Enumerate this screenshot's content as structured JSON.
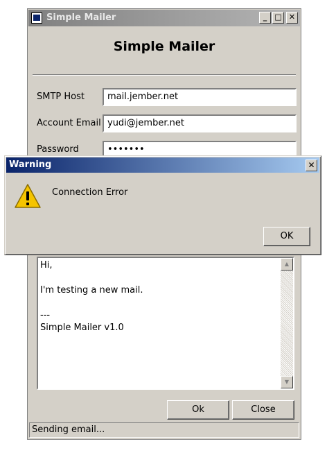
{
  "window": {
    "title": "Simple Mailer",
    "minimize_glyph": "_",
    "maximize_glyph": "□",
    "close_glyph": "✕"
  },
  "form": {
    "heading": "Simple Mailer",
    "smtp_host_label": "SMTP Host",
    "smtp_host_value": "mail.jember.net",
    "account_email_label": "Account Email",
    "account_email_value": "yudi@jember.net",
    "password_label": "Password",
    "password_value": "•••••••",
    "message_body": "Hi,\n\nI'm testing a new mail.\n\n---\nSimple Mailer v1.0"
  },
  "buttons": {
    "ok_label": "Ok",
    "close_label": "Close"
  },
  "status": {
    "text": "Sending email..."
  },
  "dialog": {
    "title": "Warning",
    "message": "Connection Error",
    "ok_label": "OK",
    "close_glyph": "✕",
    "icon": "warning-icon"
  },
  "icons": {
    "scroll_up": "▲",
    "scroll_down": "▼"
  },
  "colors": {
    "window_bg": "#d4d0c8",
    "dialog_title_start": "#0a246a",
    "dialog_title_end": "#a6caf0",
    "inactive_title_start": "#808080",
    "warning_yellow": "#f5c400"
  }
}
